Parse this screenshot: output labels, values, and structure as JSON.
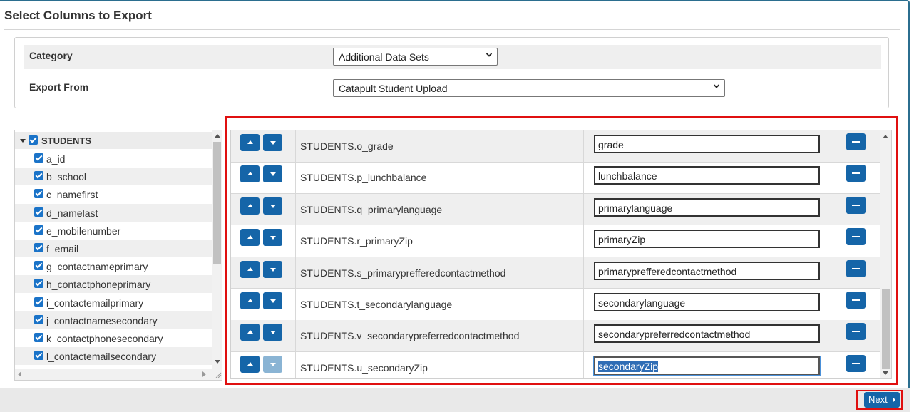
{
  "page": {
    "title": "Select Columns to Export"
  },
  "filters": {
    "category": {
      "label": "Category",
      "value": "Additional Data Sets"
    },
    "export_from": {
      "label": "Export From",
      "value": "Catapult Student Upload"
    }
  },
  "tree": {
    "root": {
      "label": "STUDENTS",
      "checked": true,
      "expanded": true
    },
    "items": [
      {
        "label": "a_id",
        "checked": true
      },
      {
        "label": "b_school",
        "checked": true
      },
      {
        "label": "c_namefirst",
        "checked": true
      },
      {
        "label": "d_namelast",
        "checked": true
      },
      {
        "label": "e_mobilenumber",
        "checked": true
      },
      {
        "label": "f_email",
        "checked": true
      },
      {
        "label": "g_contactnameprimary",
        "checked": true
      },
      {
        "label": "h_contactphoneprimary",
        "checked": true
      },
      {
        "label": "i_contactemailprimary",
        "checked": true
      },
      {
        "label": "j_contactnamesecondary",
        "checked": true
      },
      {
        "label": "k_contactphonesecondary",
        "checked": true
      },
      {
        "label": "l_contactemailsecondary",
        "checked": true
      }
    ]
  },
  "columns": [
    {
      "field": "STUDENTS.o_grade",
      "alias": "grade"
    },
    {
      "field": "STUDENTS.p_lunchbalance",
      "alias": "lunchbalance"
    },
    {
      "field": "STUDENTS.q_primarylanguage",
      "alias": "primarylanguage"
    },
    {
      "field": "STUDENTS.r_primaryZip",
      "alias": "primaryZip"
    },
    {
      "field": "STUDENTS.s_primaryprefferedcontactmethod",
      "alias": "primaryprefferedcontactmethod"
    },
    {
      "field": "STUDENTS.t_secondarylanguage",
      "alias": "secondarylanguage"
    },
    {
      "field": "STUDENTS.v_secondarypreferredcontactmethod",
      "alias": "secondarypreferredcontactmethod"
    },
    {
      "field": "STUDENTS.u_secondaryZip",
      "alias": "secondaryZip",
      "move_down_disabled": true,
      "focused": true
    }
  ],
  "footer": {
    "next_label": "Next"
  },
  "icons": {
    "move_up": "arrow-up-icon",
    "move_down": "arrow-down-icon",
    "remove": "minus-icon",
    "next": "caret-right-icon",
    "dropdown": "chevron-down-icon",
    "checkbox": "checkbox-checked-icon"
  },
  "colors": {
    "accent": "#1565a8",
    "highlight_outline": "#e01010",
    "checkbox": "#1a73c8"
  }
}
